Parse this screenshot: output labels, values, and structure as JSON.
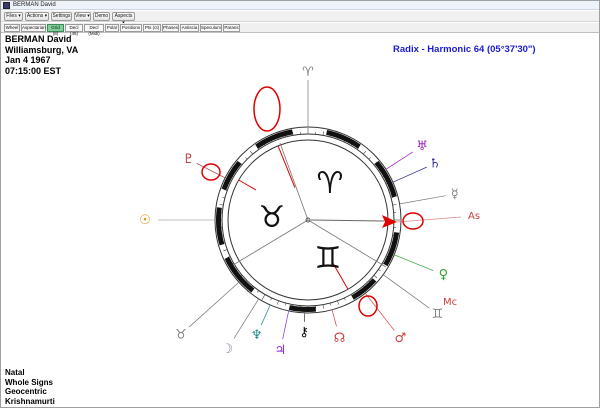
{
  "window": {
    "title": "BERMAN David"
  },
  "menu": [
    {
      "label": "Files ▾"
    },
    {
      "label": "Actions ▾"
    },
    {
      "label": "Settings"
    },
    {
      "label": "View ▾"
    },
    {
      "label": "Demo"
    },
    {
      "label": "Aspects ▾"
    }
  ],
  "tabs": [
    {
      "label": "Wheel"
    },
    {
      "label": "Aspectarian"
    },
    {
      "label": "Grid (8)"
    },
    {
      "label": "Decl (46)"
    },
    {
      "label": "Decl (Midi)"
    },
    {
      "label": "Polar"
    },
    {
      "label": "Positions"
    },
    {
      "label": "Pts (ct)"
    },
    {
      "label": "Phases"
    },
    {
      "label": "Antiscia"
    },
    {
      "label": "Speculum"
    },
    {
      "label": "Parans"
    }
  ],
  "chart_info": {
    "name": "BERMAN David",
    "place": "Williamsburg, VA",
    "date": "Jan 4 1967",
    "time": "07:15:00  EST"
  },
  "chart_title": "Radix - Harmonic 64 (05°37'30\")",
  "footer": {
    "line1": "Natal",
    "line2": "Whole Signs",
    "line3": "Geocentric",
    "line4": "Krishnamurti"
  },
  "wheel": {
    "house_signs": [
      "♈",
      "♉",
      "♊"
    ],
    "outer_symbols": [
      {
        "name": "aries-glyph",
        "glyph": "♈",
        "color": "#808080"
      },
      {
        "name": "pluto-glyph",
        "glyph": "♇",
        "color": "#b03030"
      },
      {
        "name": "sun-glyph",
        "glyph": "☉",
        "color": "#e08a00"
      },
      {
        "name": "taurus-glyph",
        "glyph": "♉",
        "color": "#808080"
      },
      {
        "name": "moon-glyph",
        "glyph": "☽",
        "color": "#8080a0"
      },
      {
        "name": "neptune-glyph",
        "glyph": "♆",
        "color": "#1a8a8a"
      },
      {
        "name": "jupiter-glyph",
        "glyph": "♃",
        "color": "#8a2be2"
      },
      {
        "name": "chiron-glyph",
        "glyph": "⚷",
        "color": "#000000"
      },
      {
        "name": "node-glyph",
        "glyph": "☊",
        "color": "#d04040"
      },
      {
        "name": "mars-glyph",
        "glyph": "♂",
        "color": "#d04040"
      },
      {
        "name": "gemini-glyph",
        "glyph": "♊",
        "color": "#808080"
      },
      {
        "name": "venus-glyph",
        "glyph": "♀",
        "color": "#2aa02a"
      },
      {
        "name": "mercury-glyph",
        "glyph": "☿",
        "color": "#808080"
      },
      {
        "name": "saturn-glyph",
        "glyph": "♄",
        "color": "#3030a0"
      },
      {
        "name": "uranus-glyph",
        "glyph": "♅",
        "color": "#a020c0"
      }
    ],
    "asc_label": "As",
    "mc_label": "Mc"
  }
}
